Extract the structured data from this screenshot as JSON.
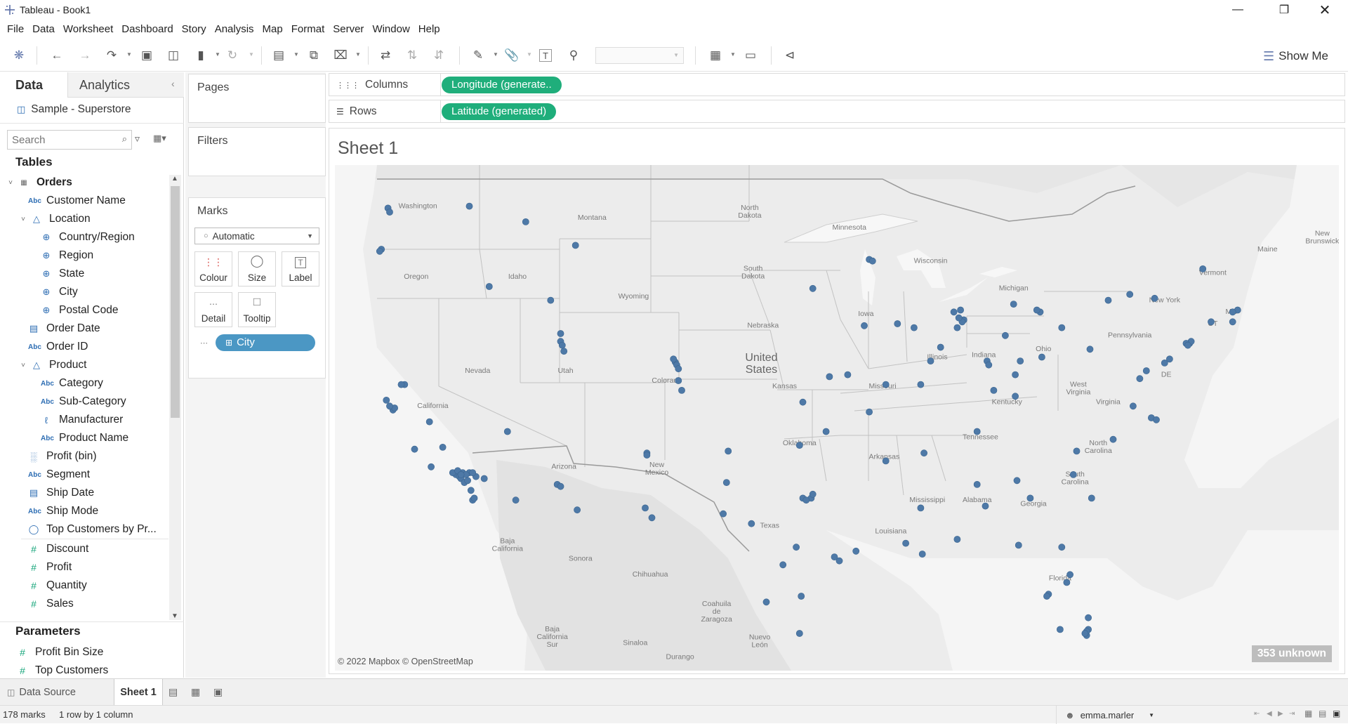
{
  "window": {
    "title": "Tableau - Book1"
  },
  "menu": [
    "File",
    "Data",
    "Worksheet",
    "Dashboard",
    "Story",
    "Analysis",
    "Map",
    "Format",
    "Server",
    "Window",
    "Help"
  ],
  "toolbar": {
    "show_me_label": "Show Me"
  },
  "datapane": {
    "tab_data": "Data",
    "tab_analytics": "Analytics",
    "datasource": "Sample - Superstore",
    "search_placeholder": "Search",
    "tables_heading": "Tables",
    "table_name": "Orders",
    "fields": [
      {
        "label": "Customer Name",
        "icon": "Abc"
      },
      {
        "label": "Location",
        "icon": "hier"
      },
      {
        "label": "Country/Region",
        "icon": "globe"
      },
      {
        "label": "Region",
        "icon": "globe"
      },
      {
        "label": "State",
        "icon": "globe"
      },
      {
        "label": "City",
        "icon": "globe"
      },
      {
        "label": "Postal Code",
        "icon": "globe"
      },
      {
        "label": "Order Date",
        "icon": "date"
      },
      {
        "label": "Order ID",
        "icon": "Abc"
      },
      {
        "label": "Product",
        "icon": "hier"
      },
      {
        "label": "Category",
        "icon": "Abc"
      },
      {
        "label": "Sub-Category",
        "icon": "Abc"
      },
      {
        "label": "Manufacturer",
        "icon": "clip"
      },
      {
        "label": "Product Name",
        "icon": "Abc"
      },
      {
        "label": "Profit (bin)",
        "icon": "bin"
      },
      {
        "label": "Segment",
        "icon": "Abc"
      },
      {
        "label": "Ship Date",
        "icon": "date"
      },
      {
        "label": "Ship Mode",
        "icon": "Abc"
      },
      {
        "label": "Top Customers by Pr...",
        "icon": "set"
      },
      {
        "label": "Discount",
        "icon": "#"
      },
      {
        "label": "Profit",
        "icon": "#"
      },
      {
        "label": "Quantity",
        "icon": "#"
      },
      {
        "label": "Sales",
        "icon": "#"
      }
    ],
    "parameters_heading": "Parameters",
    "parameters": [
      "Profit Bin Size",
      "Top Customers"
    ]
  },
  "shelves": {
    "pages_label": "Pages",
    "filters_label": "Filters",
    "marks_label": "Marks",
    "marks_type": "Automatic",
    "mark_buttons": [
      "Colour",
      "Size",
      "Label",
      "Detail",
      "Tooltip"
    ],
    "detail_pill": "City",
    "columns_label": "Columns",
    "rows_label": "Rows",
    "columns_pill": "Longitude (generate..",
    "rows_pill": "Latitude (generated)"
  },
  "sheet": {
    "title": "Sheet 1",
    "unknown_badge": "353 unknown",
    "attribution": "© 2022 Mapbox © OpenStreetMap",
    "map_labels": [
      "Washington",
      "Montana",
      "North Dakota",
      "Minnesota",
      "Oregon",
      "Idaho",
      "South Dakota",
      "Wisconsin",
      "Wyoming",
      "Michigan",
      "New York",
      "Vermont",
      "Maine",
      "Iowa",
      "Nebraska",
      "United States",
      "Pennsylvania",
      "Nevada",
      "Utah",
      "Colorado",
      "Illinois",
      "Indiana",
      "Ohio",
      "Kansas",
      "Missouri",
      "West Virginia",
      "Virginia",
      "Kentucky",
      "California",
      "Tennessee",
      "North Carolina",
      "Oklahoma",
      "Arkansas",
      "Arizona",
      "New Mexico",
      "South Carolina",
      "Mississippi",
      "Alabama",
      "Georgia",
      "Texas",
      "Louisiana",
      "Florida",
      "Baja California",
      "Sonora",
      "Chihuahua",
      "Coahuila de Zaragoza",
      "Baja California Sur",
      "Nuevo León",
      "Sinaloa",
      "Durango",
      "CT",
      "DE",
      "MA",
      "New Brunswick"
    ]
  },
  "chart_data": {
    "type": "scatter",
    "title": "Sheet 1",
    "xlabel": "Longitude (generated)",
    "ylabel": "Latitude (generated)",
    "marks_count": 178,
    "unknown_count": 353,
    "points": [
      [
        -122.3,
        47.6
      ],
      [
        -122.2,
        47.4
      ],
      [
        -117.4,
        47.7
      ],
      [
        -122.7,
        45.5
      ],
      [
        -122.8,
        45.4
      ],
      [
        -116.2,
        43.6
      ],
      [
        -114.0,
        46.9
      ],
      [
        -111.0,
        45.7
      ],
      [
        -112.5,
        42.9
      ],
      [
        -111.9,
        40.8
      ],
      [
        -111.8,
        40.6
      ],
      [
        -111.7,
        40.3
      ],
      [
        -111.9,
        41.2
      ],
      [
        -104.99,
        39.74
      ],
      [
        -104.9,
        39.6
      ],
      [
        -104.8,
        39.4
      ],
      [
        -104.6,
        38.3
      ],
      [
        -104.8,
        38.8
      ],
      [
        -105.1,
        39.9
      ],
      [
        -122.4,
        37.8
      ],
      [
        -122.0,
        37.3
      ],
      [
        -121.9,
        37.4
      ],
      [
        -121.3,
        38.6
      ],
      [
        -121.5,
        38.6
      ],
      [
        -119.8,
        36.7
      ],
      [
        -122.2,
        37.5
      ],
      [
        -118.2,
        34.0
      ],
      [
        -118.4,
        34.1
      ],
      [
        -118.0,
        33.9
      ],
      [
        -117.9,
        33.8
      ],
      [
        -117.7,
        33.6
      ],
      [
        -117.2,
        32.7
      ],
      [
        -117.1,
        32.8
      ],
      [
        -117.3,
        33.2
      ],
      [
        -117.4,
        34.1
      ],
      [
        -116.5,
        33.8
      ],
      [
        -115.1,
        36.2
      ],
      [
        -119.0,
        35.4
      ],
      [
        -120.7,
        35.3
      ],
      [
        -119.7,
        34.4
      ],
      [
        -117.8,
        34.1
      ],
      [
        -117.6,
        34.0
      ],
      [
        -117.0,
        33.9
      ],
      [
        -117.2,
        34.1
      ],
      [
        -118.1,
        34.2
      ],
      [
        -117.9,
        34.0
      ],
      [
        -117.5,
        33.7
      ],
      [
        -112.1,
        33.5
      ],
      [
        -111.9,
        33.4
      ],
      [
        -110.9,
        32.2
      ],
      [
        -114.6,
        32.7
      ],
      [
        -106.7,
        35.1
      ],
      [
        -106.7,
        35.0
      ],
      [
        -106.8,
        32.3
      ],
      [
        -101.8,
        35.2
      ],
      [
        -101.9,
        33.6
      ],
      [
        -97.5,
        35.5
      ],
      [
        -95.9,
        36.2
      ],
      [
        -96.8,
        32.8
      ],
      [
        -97.3,
        32.8
      ],
      [
        -96.7,
        33.0
      ],
      [
        -97.1,
        32.7
      ],
      [
        -97.7,
        30.3
      ],
      [
        -98.5,
        29.4
      ],
      [
        -95.4,
        29.8
      ],
      [
        -95.1,
        29.6
      ],
      [
        -94.1,
        30.1
      ],
      [
        -97.4,
        27.8
      ],
      [
        -97.5,
        25.9
      ],
      [
        -99.5,
        27.5
      ],
      [
        -100.4,
        31.5
      ],
      [
        -106.4,
        31.8
      ],
      [
        -102.1,
        32.0
      ],
      [
        -97.3,
        37.7
      ],
      [
        -95.7,
        39.0
      ],
      [
        -94.6,
        39.1
      ],
      [
        -92.3,
        38.6
      ],
      [
        -90.2,
        38.6
      ],
      [
        -93.3,
        37.2
      ],
      [
        -93.3,
        44.98
      ],
      [
        -93.1,
        44.9
      ],
      [
        -96.7,
        43.5
      ],
      [
        -93.6,
        41.6
      ],
      [
        -91.6,
        41.7
      ],
      [
        -90.6,
        41.5
      ],
      [
        -87.6,
        41.9
      ],
      [
        -87.7,
        41.8
      ],
      [
        -87.9,
        42.0
      ],
      [
        -88.0,
        41.5
      ],
      [
        -89.6,
        39.8
      ],
      [
        -89.0,
        40.5
      ],
      [
        -88.2,
        42.3
      ],
      [
        -87.8,
        42.4
      ],
      [
        -86.2,
        39.8
      ],
      [
        -86.1,
        39.6
      ],
      [
        -85.1,
        41.1
      ],
      [
        -84.6,
        42.7
      ],
      [
        -83.0,
        42.3
      ],
      [
        -83.2,
        42.4
      ],
      [
        -82.9,
        40.0
      ],
      [
        -81.7,
        41.5
      ],
      [
        -84.5,
        39.1
      ],
      [
        -84.2,
        39.8
      ],
      [
        -85.8,
        38.3
      ],
      [
        -84.5,
        38.0
      ],
      [
        -86.8,
        36.2
      ],
      [
        -90.0,
        35.1
      ],
      [
        -92.3,
        34.7
      ],
      [
        -90.2,
        32.3
      ],
      [
        -91.1,
        30.5
      ],
      [
        -90.1,
        29.95
      ],
      [
        -88.0,
        30.7
      ],
      [
        -86.8,
        33.5
      ],
      [
        -86.3,
        32.4
      ],
      [
        -84.4,
        33.7
      ],
      [
        -83.6,
        32.8
      ],
      [
        -84.3,
        30.4
      ],
      [
        -81.7,
        30.3
      ],
      [
        -82.5,
        27.9
      ],
      [
        -82.6,
        27.8
      ],
      [
        -81.4,
        28.5
      ],
      [
        -81.2,
        28.9
      ],
      [
        -80.2,
        25.8
      ],
      [
        -80.1,
        26.1
      ],
      [
        -80.1,
        26.7
      ],
      [
        -80.2,
        26.0
      ],
      [
        -80.3,
        25.9
      ],
      [
        -81.8,
        26.1
      ],
      [
        -80.8,
        35.2
      ],
      [
        -78.6,
        35.8
      ],
      [
        -81.0,
        34.0
      ],
      [
        -79.9,
        32.8
      ],
      [
        -77.4,
        37.5
      ],
      [
        -76.3,
        36.9
      ],
      [
        -76.0,
        36.8
      ],
      [
        -77.0,
        38.9
      ],
      [
        -75.2,
        39.9
      ],
      [
        -74.0,
        40.7
      ],
      [
        -73.9,
        40.8
      ],
      [
        -74.2,
        40.7
      ],
      [
        -74.1,
        40.6
      ],
      [
        -75.5,
        39.7
      ],
      [
        -76.6,
        39.3
      ],
      [
        -73.2,
        44.5
      ],
      [
        -76.1,
        43.0
      ],
      [
        -77.6,
        43.2
      ],
      [
        -78.9,
        42.9
      ],
      [
        -80.0,
        40.4
      ],
      [
        -71.4,
        41.8
      ],
      [
        -71.1,
        42.4
      ],
      [
        -71.4,
        42.3
      ],
      [
        -72.7,
        41.8
      ]
    ]
  }
}
